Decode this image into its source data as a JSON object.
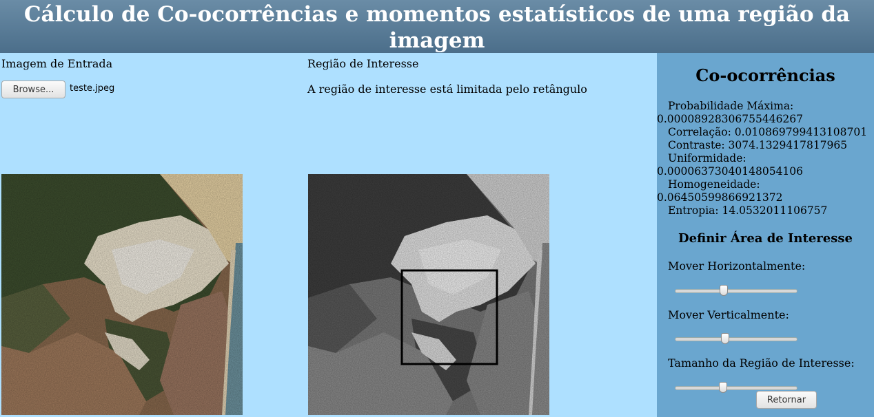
{
  "header": {
    "title": "Cálculo de Co-ocorrências e momentos estatísticos de uma região da imagem"
  },
  "input": {
    "title": "Imagem de Entrada",
    "browse_label": "Browse...",
    "file_name": "teste.jpeg"
  },
  "roi": {
    "title": "Região de Interesse",
    "description": "A região de interesse está limitada pelo retângulo"
  },
  "sidebar": {
    "cooc_title": "Co-ocorrências",
    "stats": {
      "prob_label": "Probabilidade Máxima:",
      "prob_value": "0.00008928306755446267",
      "corr": "Correlação: 0.010869799413108701",
      "contrast": "Contraste: 3074.1329417817965",
      "unif_label": "Uniformidade:",
      "unif_value": "0.00006373040148054106",
      "homo_label": "Homogeneidade:",
      "homo_value": "0.06450599866921372",
      "entropy": "Entropia: 14.0532011106757"
    },
    "roi_title": "Definir Área de Interesse",
    "sliders": {
      "horizontal": {
        "label": "Mover Horizontalmente:",
        "value": 0.4
      },
      "vertical": {
        "label": "Mover Verticalmente:",
        "value": 0.41
      },
      "size": {
        "label": "Tamanho da Região de Interesse:",
        "value": 0.39
      }
    },
    "return_label": "Retornar"
  },
  "colors": {
    "header_bg": "#4b6e8a",
    "main_bg": "#aee0ff",
    "sidebar_bg": "#6aa6cf"
  }
}
